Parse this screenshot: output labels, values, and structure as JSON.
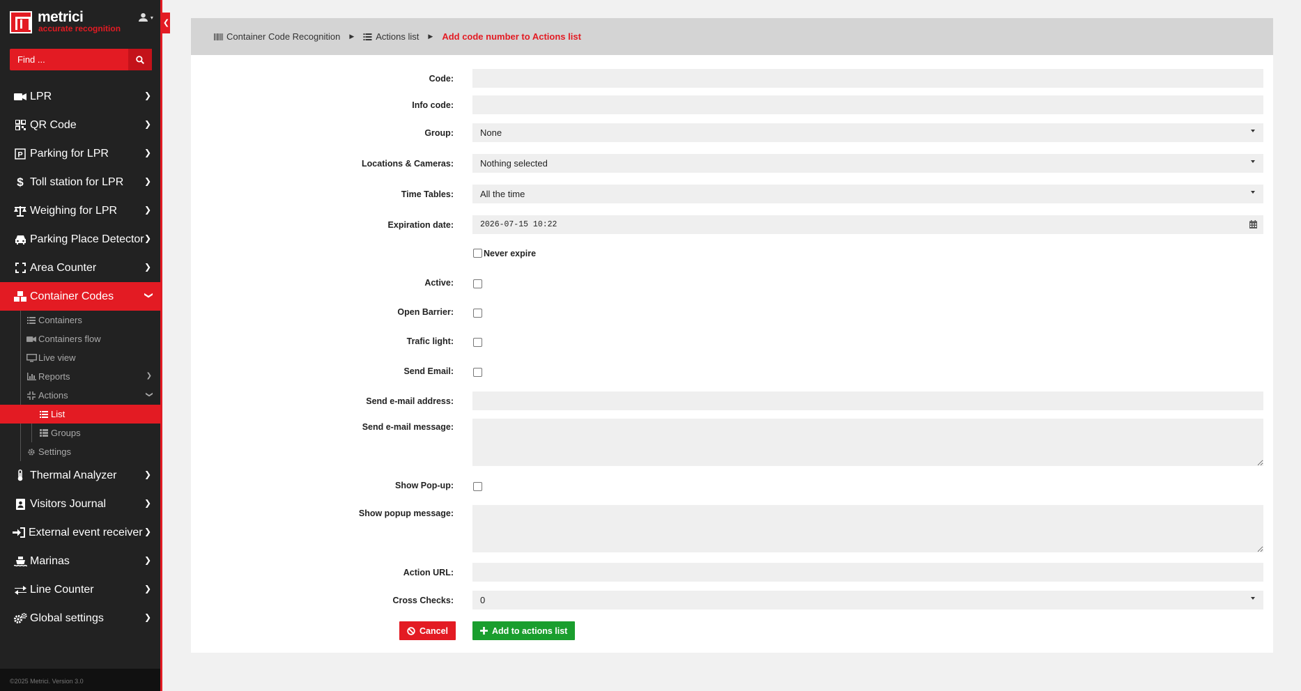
{
  "brand": {
    "name": "metrici",
    "tagline": "accurate recognition"
  },
  "search": {
    "placeholder": "Find ..."
  },
  "nav": {
    "lpr": "LPR",
    "qr": "QR Code",
    "parking": "Parking for LPR",
    "toll": "Toll station for LPR",
    "weighing": "Weighing for LPR",
    "place_detector": "Parking Place Detector",
    "area_counter": "Area Counter",
    "container_codes": "Container Codes",
    "containers": "Containers",
    "containers_flow": "Containers flow",
    "live_view": "Live view",
    "reports": "Reports",
    "actions": "Actions",
    "list": "List",
    "groups": "Groups",
    "settings": "Settings",
    "thermal": "Thermal Analyzer",
    "visitors": "Visitors Journal",
    "external": "External event receiver",
    "marinas": "Marinas",
    "line_counter": "Line Counter",
    "global": "Global settings"
  },
  "footer": "©2025 Metrici. Version 3.0",
  "breadcrumb": {
    "root": "Container Code Recognition",
    "list": "Actions list",
    "current": "Add code number to Actions list"
  },
  "form": {
    "code_label": "Code:",
    "info_code_label": "Info code:",
    "group_label": "Group:",
    "group_value": "None",
    "locations_label": "Locations & Cameras:",
    "locations_value": "Nothing selected",
    "time_tables_label": "Time Tables:",
    "time_tables_value": "All the time",
    "expiration_label": "Expiration date:",
    "expiration_value": "2026-07-15 10:22",
    "never_expire_label": "Never expire",
    "active_label": "Active:",
    "open_barrier_label": "Open Barrier:",
    "trafic_light_label": "Trafic light:",
    "send_email_label": "Send Email:",
    "email_address_label": "Send e-mail address:",
    "email_message_label": "Send e-mail message:",
    "show_popup_label": "Show Pop-up:",
    "popup_message_label": "Show popup message:",
    "action_url_label": "Action URL:",
    "cross_checks_label": "Cross Checks:",
    "cross_checks_value": "0"
  },
  "buttons": {
    "cancel": "Cancel",
    "add": "Add to actions list"
  },
  "colors": {
    "accent": "#e31b23",
    "success": "#1a9e2e",
    "sidebar": "#222222"
  }
}
